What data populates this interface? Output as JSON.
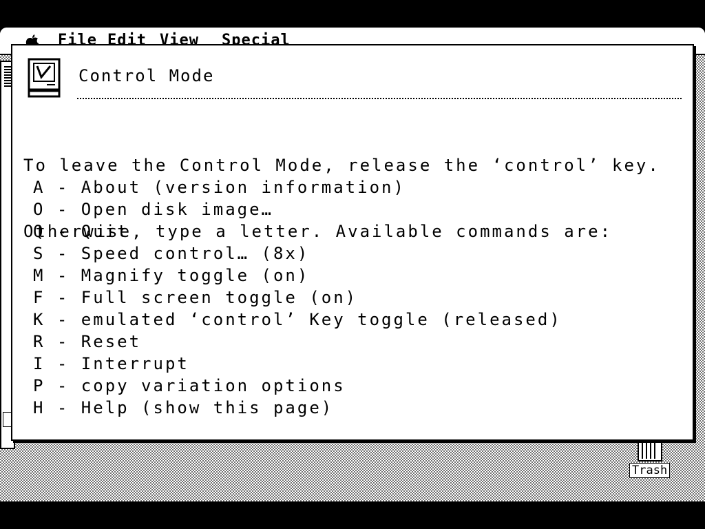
{
  "menubar": {
    "apple_icon": "apple-icon",
    "items": [
      "File",
      "Edit",
      "View",
      "Special"
    ]
  },
  "desktop": {
    "trash_label": "Trash",
    "trash_icon": "trash-icon"
  },
  "dialog": {
    "icon": "mac-screen-icon",
    "title": "Control Mode",
    "intro_lines": [
      "To leave the Control Mode, release the ‘control’ key.",
      "Otherwise, type a letter. Available commands are:"
    ],
    "commands": [
      "A - About (version information)",
      "O - Open disk image…",
      "Q - Quit",
      "S - Speed control… (8x)",
      "M - Magnify toggle (on)",
      "F - Full screen toggle (on)",
      "K - emulated ‘control’ Key toggle (released)",
      "R - Reset",
      "I - Interrupt",
      "P - copy variation options",
      "H - Help (show this page)"
    ]
  }
}
